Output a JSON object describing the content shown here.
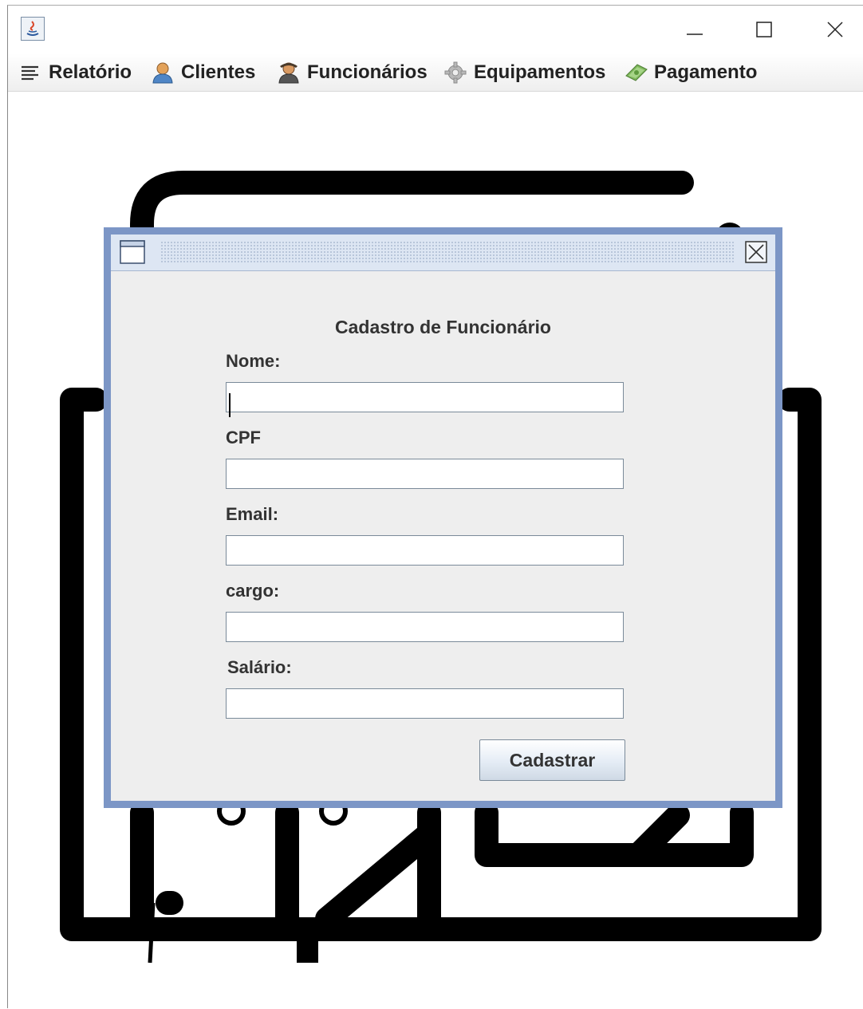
{
  "menu": {
    "items": [
      {
        "label": "Relatório",
        "icon": "list-icon"
      },
      {
        "label": "Clientes",
        "icon": "user-icon"
      },
      {
        "label": "Funcionários",
        "icon": "employee-icon"
      },
      {
        "label": "Equipamentos",
        "icon": "gear-icon"
      },
      {
        "label": "Pagamento",
        "icon": "money-icon"
      }
    ]
  },
  "dialog": {
    "title": "Cadastro de Funcionário",
    "fields": [
      {
        "label": "Nome:",
        "value": ""
      },
      {
        "label": "CPF",
        "value": ""
      },
      {
        "label": "Email:",
        "value": ""
      },
      {
        "label": "cargo:",
        "value": ""
      },
      {
        "label": "Salário:",
        "value": ""
      }
    ],
    "submit_label": "Cadastrar"
  },
  "colors": {
    "dialog_border": "#7c96c6",
    "dialog_background": "#eeeeee",
    "artwork": "#000000"
  }
}
